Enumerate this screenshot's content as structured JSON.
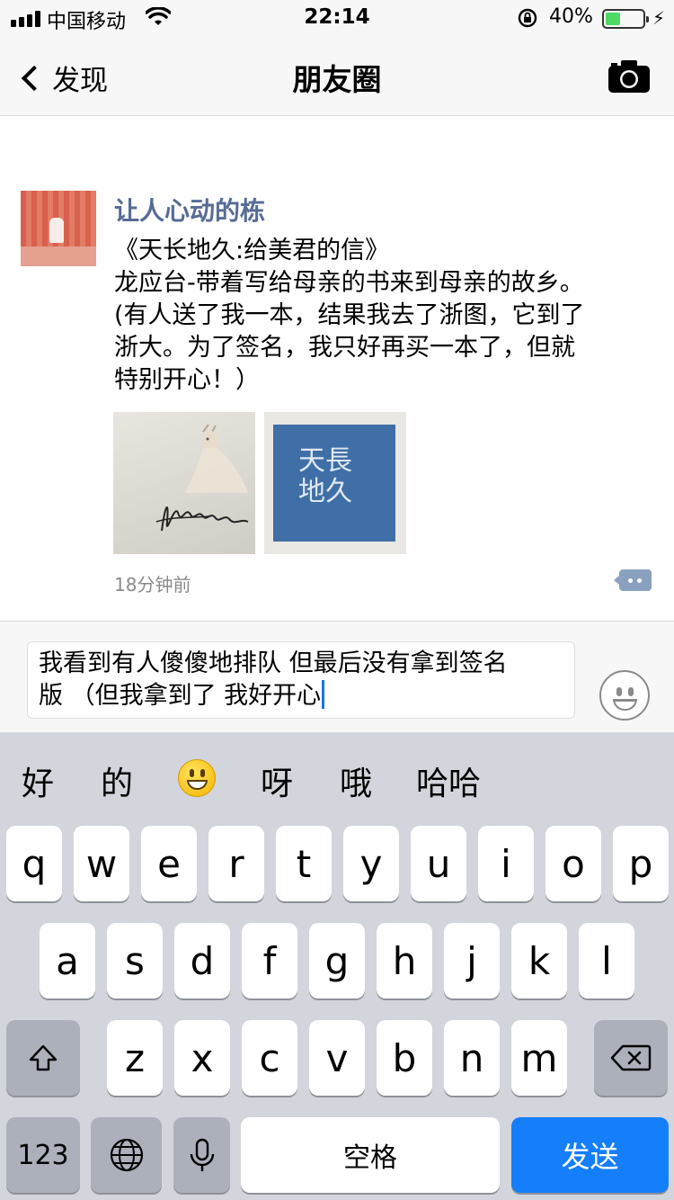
{
  "status_bar": {
    "carrier": "中国移动",
    "time": "22:14",
    "battery_percent": "40%",
    "battery_level": 0.4,
    "battery_color": "#4cd964"
  },
  "nav": {
    "back_label": "发现",
    "title": "朋友圈",
    "camera_icon": "camera-icon"
  },
  "post": {
    "author": "让人心动的栋",
    "author_color": "#576b95",
    "text_lines": [
      "《天长地久:给美君的信》",
      "龙应台-带着写给母亲的书来到母亲的故乡。",
      "(有人送了我一本，结果我去了浙图，它到了",
      "浙大。为了签名，我只好再买一本了，但就",
      "特别开心！）"
    ],
    "images": [
      {
        "name": "deer-signature-photo"
      },
      {
        "name": "book-cover-photo",
        "text_line1": "天長",
        "text_line2": "地久"
      }
    ],
    "time_ago": "18分钟前"
  },
  "comment_input": {
    "value_line1": "我看到有人傻傻地排队 但最后没有拿到签名",
    "value_line2": "版 （但我拿到了 我好开心"
  },
  "keyboard": {
    "candidates": [
      "好",
      "的",
      "呀",
      "哦",
      "哈哈"
    ],
    "row1": [
      "q",
      "w",
      "e",
      "r",
      "t",
      "y",
      "u",
      "i",
      "o",
      "p"
    ],
    "row2": [
      "a",
      "s",
      "d",
      "f",
      "g",
      "h",
      "j",
      "k",
      "l"
    ],
    "row3": [
      "z",
      "x",
      "c",
      "v",
      "b",
      "n",
      "m"
    ],
    "numbers_label": "123",
    "space_label": "空格",
    "send_label": "发送",
    "send_color": "#147efb"
  }
}
